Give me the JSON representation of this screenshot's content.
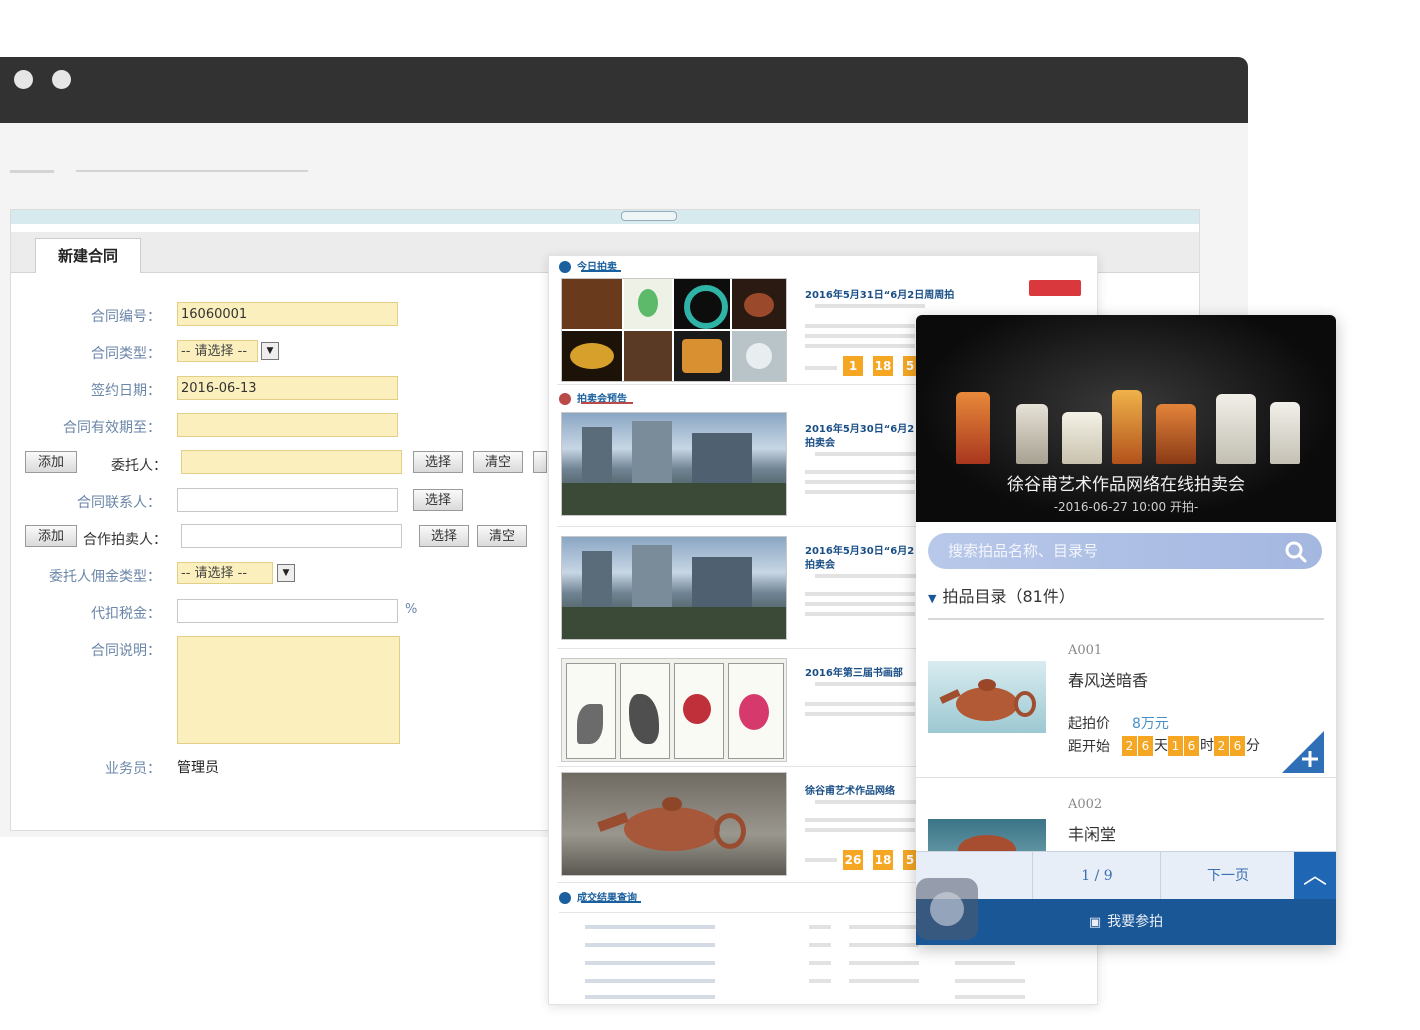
{
  "contract_form": {
    "tab": "新建合同",
    "fields": {
      "contract_no": {
        "label": "合同编号：",
        "value": "16060001"
      },
      "contract_type": {
        "label": "合同类型：",
        "value": "-- 请选择 --"
      },
      "sign_date": {
        "label": "签约日期：",
        "value": "2016-06-13"
      },
      "valid_until": {
        "label": "合同有效期至：",
        "value": ""
      },
      "consignor": {
        "label": "委托人："
      },
      "contact": {
        "label": "合同联系人："
      },
      "co_auctioneer": {
        "label": "合作拍卖人："
      },
      "commission_type": {
        "label": "委托人佣金类型：",
        "value": "-- 请选择 --"
      },
      "withholding_tax": {
        "label": "代扣税金：",
        "unit": "%"
      },
      "description": {
        "label": "合同说明："
      },
      "salesperson": {
        "label": "业务员：",
        "value": "管理员"
      }
    },
    "buttons": {
      "add": "添加",
      "select": "选择",
      "clear": "清空"
    }
  },
  "web_page": {
    "sections": {
      "today": "今日拍卖",
      "preview": "拍卖会预告",
      "results": "成交结果查询"
    },
    "rows": [
      {
        "title": "2016年5月31日“6月2日周周拍",
        "countdown": [
          "1",
          "18",
          "5"
        ]
      },
      {
        "title": "2016年5月30日“6月2",
        "subtitle": "拍卖会"
      },
      {
        "title": "2016年5月30日“6月2",
        "subtitle": "拍卖会"
      },
      {
        "title": "2016年第三届书画部"
      },
      {
        "title": "徐谷甫艺术作品网络",
        "countdown": [
          "26",
          "18",
          "5"
        ]
      }
    ]
  },
  "mobile": {
    "hero_title": "徐谷甫艺术作品网络在线拍卖会",
    "hero_subtitle": "-2016-06-27 10:00 开拍-",
    "search_placeholder": "搜索拍品名称、目录号",
    "catalog_title": "拍品目录（81件）",
    "lots": [
      {
        "number": "A001",
        "name": "春风送暗香",
        "start_label": "起拍价",
        "start_price": "8万元",
        "countdown_label": "距开始",
        "countdown": {
          "days": [
            "2",
            "6"
          ],
          "day_unit": "天",
          "hours": [
            "1",
            "6"
          ],
          "hour_unit": "时",
          "minutes": [
            "2",
            "6"
          ],
          "minute_unit": "分"
        }
      },
      {
        "number": "A002",
        "name": "丰闲堂"
      }
    ],
    "pager": {
      "page": "1 / 9",
      "next": "下一页"
    },
    "join_label": "我要参拍"
  },
  "colors": {
    "accent_blue": "#1a5796",
    "highlight_orange": "#f5a623",
    "field_yellow": "#fbf0bd"
  }
}
